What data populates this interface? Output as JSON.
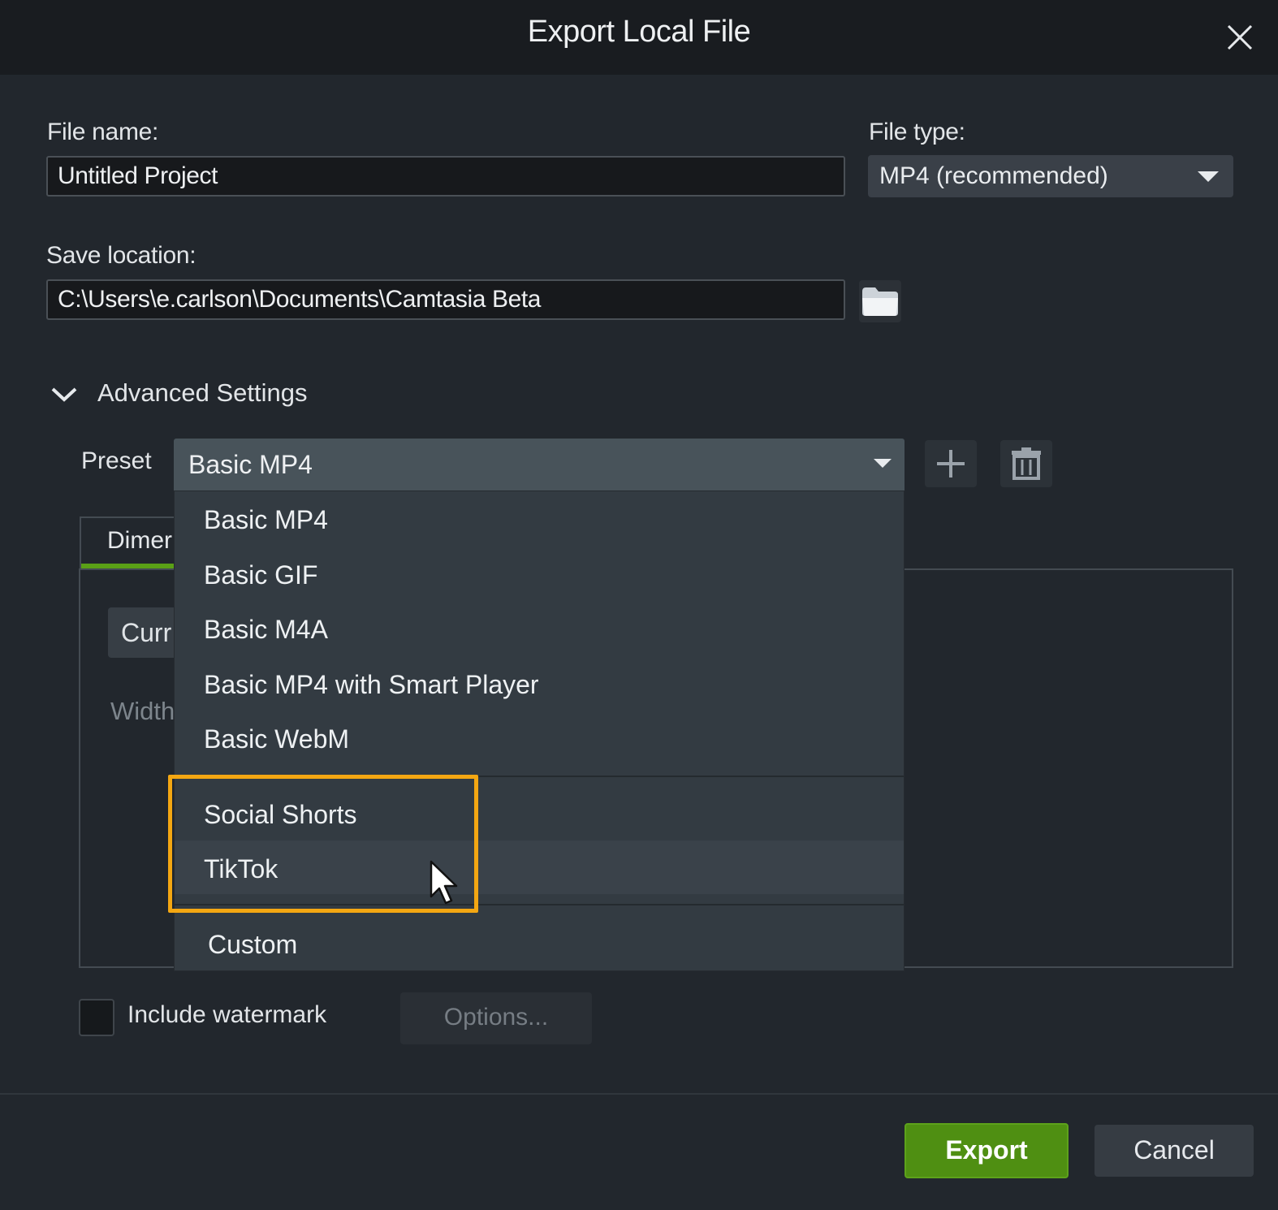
{
  "window": {
    "title": "Export Local File"
  },
  "file_name": {
    "label": "File name:",
    "value": "Untitled Project"
  },
  "file_type": {
    "label": "File type:",
    "value": "MP4 (recommended)"
  },
  "save_location": {
    "label": "Save location:",
    "value": "C:\\Users\\e.carlson\\Documents\\Camtasia Beta"
  },
  "advanced": {
    "label": "Advanced Settings"
  },
  "preset": {
    "label": "Preset",
    "selected": "Basic MP4",
    "menu": {
      "group1": [
        "Basic MP4",
        "Basic GIF",
        "Basic M4A",
        "Basic MP4 with Smart Player",
        "Basic WebM"
      ],
      "group2": [
        "Social Shorts",
        "TikTok"
      ],
      "group3": [
        "Custom"
      ]
    }
  },
  "tabs": {
    "dimensions_partial": "Dimer"
  },
  "dimensions": {
    "select_partial": "Curr",
    "width_partial": "Width"
  },
  "watermark": {
    "label": "Include watermark",
    "options_label": "Options..."
  },
  "footer": {
    "export_label": "Export",
    "cancel_label": "Cancel"
  },
  "colors": {
    "accent_green": "#4f8f12",
    "highlight_orange": "#f4a712"
  }
}
